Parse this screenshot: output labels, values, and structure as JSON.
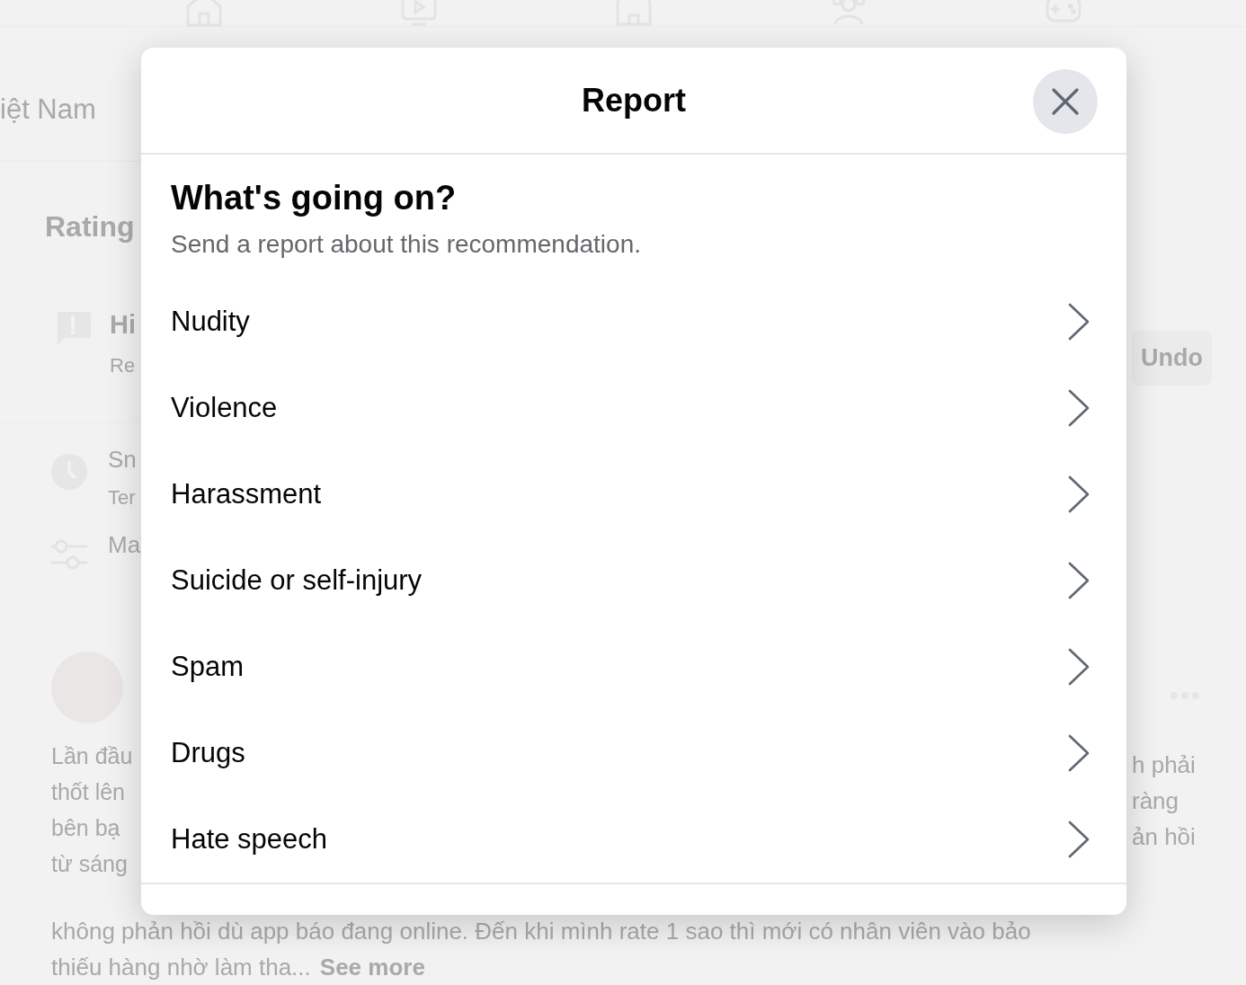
{
  "background": {
    "location": "iệt Nam",
    "section_title": "Rating",
    "notice": {
      "title": "Hi",
      "subtitle": "Re",
      "action": "Undo"
    },
    "options": [
      {
        "kind": "clock",
        "title": "Sn",
        "subtitle": "Ter"
      },
      {
        "kind": "sliders",
        "title": "Ma"
      }
    ],
    "review": {
      "left_lines": [
        "Lần đầu",
        "thốt lên",
        "bên bạ",
        "từ sáng"
      ],
      "right_lines": [
        "h phải",
        "ràng",
        "ản hồi"
      ],
      "full_line": "không phản hồi dù app báo đang online. Đến khi mình rate 1 sao thì mới có nhân viên vào bảo",
      "last_line": "thiếu hàng nhờ làm tha...",
      "see_more": "See more"
    }
  },
  "dialog": {
    "title": "Report",
    "heading": "What's going on?",
    "subtitle": "Send a report about this recommendation.",
    "options": [
      "Nudity",
      "Violence",
      "Harassment",
      "Suicide or self-injury",
      "Spam",
      "Drugs",
      "Hate speech"
    ]
  }
}
